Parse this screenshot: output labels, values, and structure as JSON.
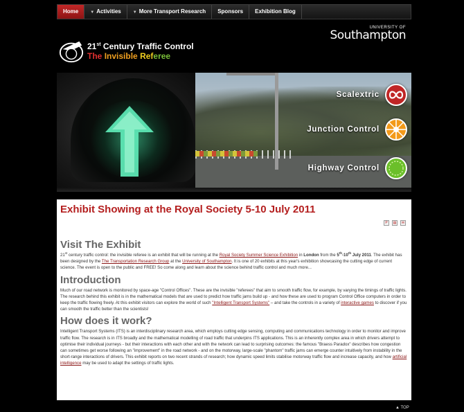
{
  "nav": {
    "items": [
      {
        "label": "Home",
        "active": true,
        "dropdown": false
      },
      {
        "label": "Activities",
        "active": false,
        "dropdown": true
      },
      {
        "label": "More Transport Research",
        "active": false,
        "dropdown": true
      },
      {
        "label": "Sponsors",
        "active": false,
        "dropdown": false
      },
      {
        "label": "Exhibition Blog",
        "active": false,
        "dropdown": false
      }
    ]
  },
  "header": {
    "university_small": "UNIVERSITY OF",
    "university_big": "Southampton",
    "logo_title_pre": "21",
    "logo_title_sup": "st",
    "logo_title_post": " Century Traffic Control",
    "logo_sub": [
      "The",
      "Invisible",
      "Ref",
      "eree"
    ]
  },
  "banner": {
    "features": [
      {
        "label": "Scalextric",
        "color": "#c02626"
      },
      {
        "label": "Junction Control",
        "color": "#f39a1a"
      },
      {
        "label": "Highway Control",
        "color": "#6bbf2a"
      }
    ]
  },
  "article": {
    "title": "Exhibit Showing at the Royal Society 5-10 July 2011",
    "tools": [
      "pdf-icon",
      "print-icon",
      "email-icon"
    ],
    "sections": {
      "visit": {
        "heading": "Visit The Exhibit",
        "t1": "21",
        "t1_sup": "st",
        "t2": " century traffic control: the invisible referee is an exhibit that will be running at the ",
        "link1": "Royal Society Summer Science Exhibition",
        "t3": " in ",
        "bold1": "London",
        "t4": " from the ",
        "bold2": "5",
        "bold2_sup": "th",
        "bold3": "-10",
        "bold3_sup": "th",
        "bold4": "July 2011",
        "t5": ". The exhibit has been designed by the ",
        "link2": "The Transportation Research Group",
        "t6": " at the ",
        "link3": "University of Southampton",
        "t7": ". It is one of 20 exhibits at this year's exhibition showcasing the cutting edge of current science. The event is open to the public and FREE! So come along and learn about the science behind traffic control and much more..."
      },
      "intro": {
        "heading": "Introduction",
        "t1": "Much of our road network is monitored by space-age \"Control Offices\". These are the invisible \"referees\" that aim to smooth traffic flow, for example, by varying the timings of traffic lights. The research behind this exhibit is in the mathematical models that are used to predict how traffic jams build up - and how these are used to program Control Office computers in order to keep the traffic flowing freely. At this exhibit visitors can explore the world of such ",
        "link1": "\"Intelligent Transport Systems\"",
        "t2": " – and take the controls in a variety of ",
        "link2": "interactive games",
        "t3": " to discover if you can smooth the traffic better than the scientists!"
      },
      "how": {
        "heading": "How does it work?",
        "t1": "Intelligent Transport Systems (ITS) is an interdisciplinary research area, which employs cutting edge sensing, computing and communications technology in order to monitor and improve traffic flow. The research is in ITS broadly and the mathematical modelling of road traffic that underpins ITS applications. This is an inherently complex area in which drivers attempt to optimise their individual journeys - but their interactions with each other and with the network can lead to surprising outcomes: the famous \"Braess Paradox\" describes how congestion can sometimes get worse following an \"improvement\" in the road network - and on the motorway, large-scale \"phantom\" traffic jams can emerge counter intuitively from instability in the short-range interactions of drivers. This exhibit reports on two recent strands of research; how dynamic speed limits stabilise motorway traffic flow and increase capacity, and how ",
        "link1": "artificial intelligence",
        "t2": " may be used to adapt the settings of traffic lights."
      }
    }
  },
  "footer": {
    "top_link": "▲ TOP"
  }
}
